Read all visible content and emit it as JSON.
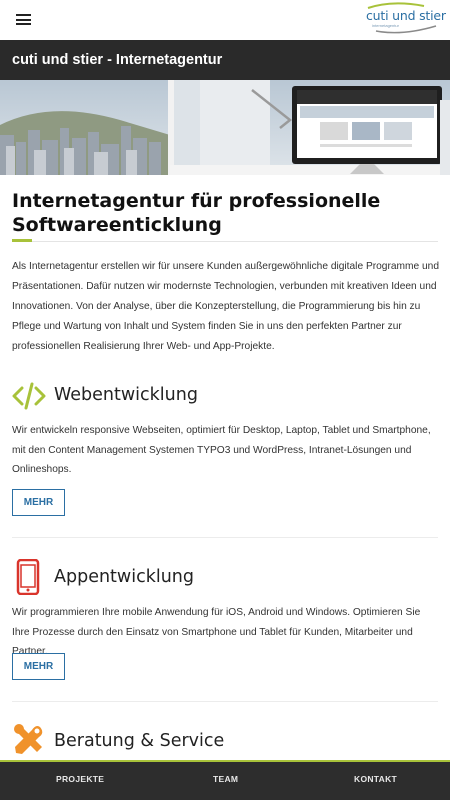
{
  "header": {
    "logo_text": "cuti und stier",
    "logo_tagline": "internetagentur",
    "menu_icon": "hamburger-menu-icon"
  },
  "titlebar": {
    "title": "cuti und stier - Internetagentur"
  },
  "main": {
    "heading": "Internetagentur für professionelle Softwareenticklung",
    "intro": "Als Internetagentur erstellen wir für unsere Kunden außergewöhnliche digitale Programme und Präsentationen. Dafür nutzen wir modernste Technologien, verbunden mit kreativen Ideen und Innovationen. Von der Analyse, über die Konzepterstellung, die Programmierung bis hin zu Pflege und Wartung von Inhalt und System finden Sie in uns den perfekten Partner zur professionellen Realisierung Ihrer Web- und App-Projekte.",
    "sections": [
      {
        "icon": "code-icon",
        "title": "Webentwicklung",
        "text": "Wir entwickeln responsive Webseiten, optimiert für Desktop, Laptop, Tablet und Smartphone, mit den Content Management Systemen TYPO3 und WordPress, Intranet-Lösungen und Onlineshops.",
        "button": "MEHR"
      },
      {
        "icon": "smartphone-icon",
        "title": "Appentwicklung",
        "text": "Wir programmieren Ihre mobile Anwendung für iOS, Android und Windows. Optimieren Sie Ihre Prozesse durch den Einsatz von Smartphone und Tablet für Kunden, Mitarbeiter und Partner.",
        "button": "MEHR"
      },
      {
        "icon": "tools-icon",
        "title": "Beratung & Service"
      }
    ]
  },
  "bottom_nav": {
    "items": [
      "PROJEKTE",
      "TEAM",
      "KONTAKT"
    ]
  },
  "colors": {
    "accent_green": "#a8c23a",
    "brand_blue": "#2b6fa3",
    "titlebar_bg": "#2a2a2a",
    "phone_red": "#d9342b",
    "tools_orange": "#f0922b"
  }
}
